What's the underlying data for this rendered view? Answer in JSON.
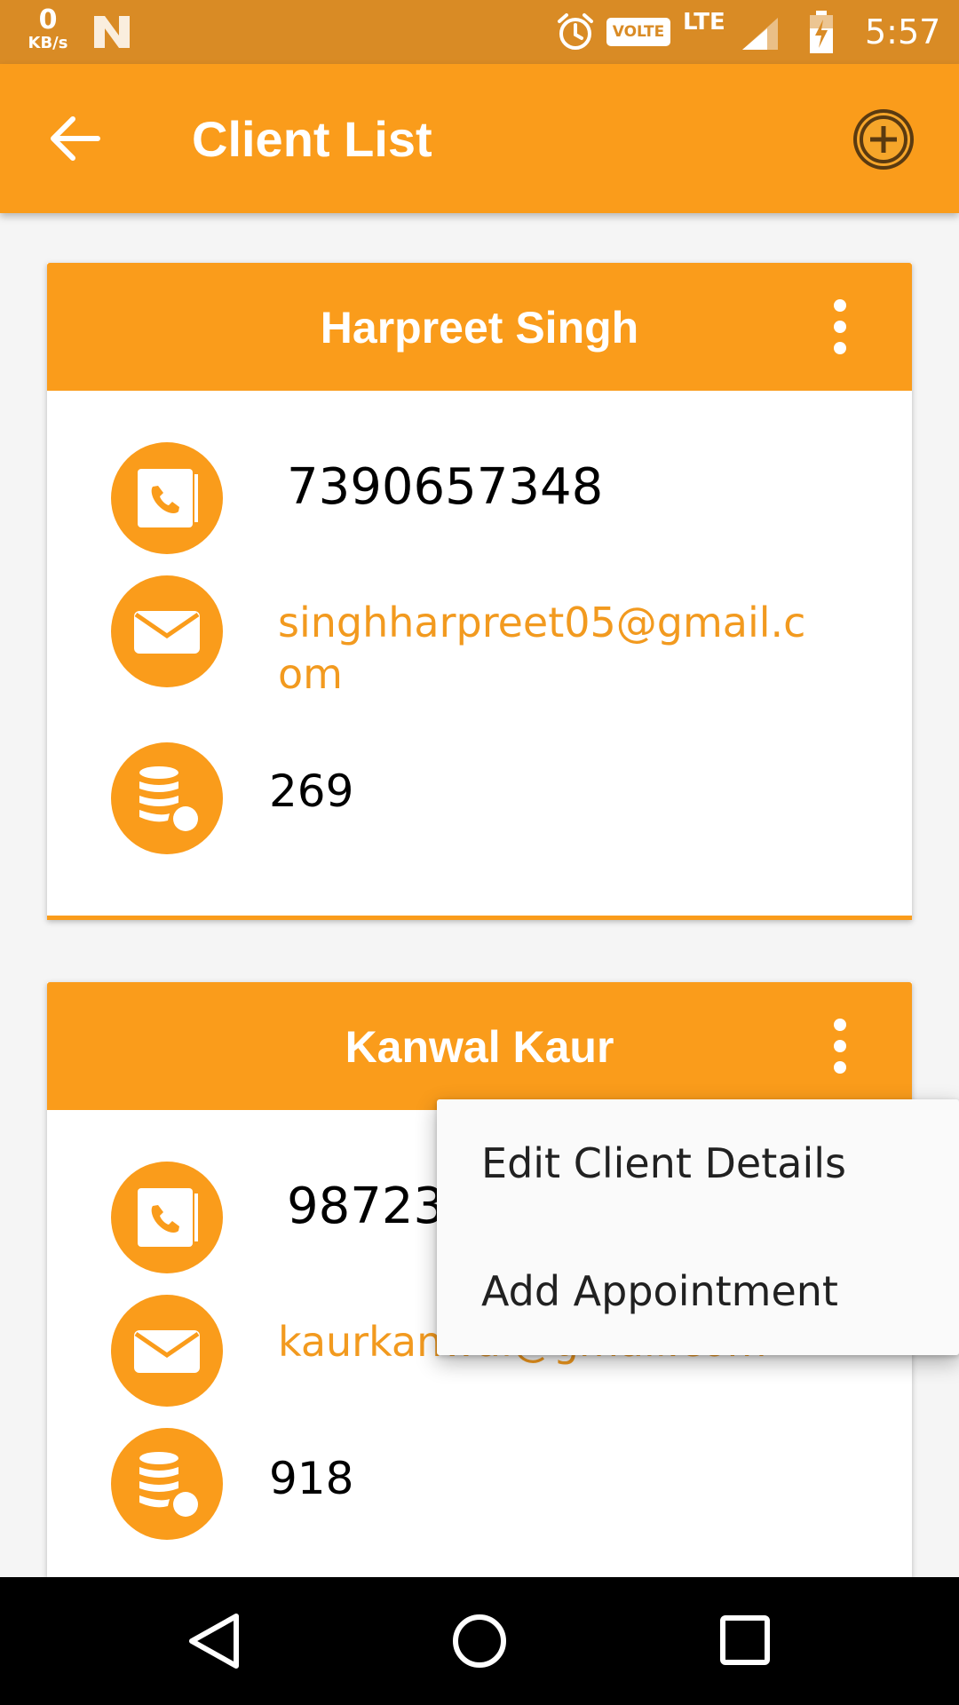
{
  "status_bar": {
    "net_speed_value": "0",
    "net_speed_unit": "KB/s",
    "volte_label": "VOLTE",
    "network_type": "LTE",
    "time": "5:57"
  },
  "app_bar": {
    "title": "Client List"
  },
  "clients": [
    {
      "name": "Harpreet Singh",
      "phone": "7390657348",
      "email": "singhharpreet05@gmail.com",
      "count": "269"
    },
    {
      "name": "Kanwal Kaur",
      "phone": "98723",
      "email": "kaurkanwal@gmail.com",
      "count": "918"
    }
  ],
  "popup_menu": {
    "items": [
      "Edit Client Details",
      "Add Appointment"
    ]
  },
  "colors": {
    "accent": "#fa9c1b",
    "status_bar": "#d98b25",
    "email_text": "#f29a1f"
  },
  "icons": [
    "back-arrow-icon",
    "add-circle-icon",
    "more-vert-icon",
    "phone-book-icon",
    "mail-icon",
    "database-icon"
  ]
}
